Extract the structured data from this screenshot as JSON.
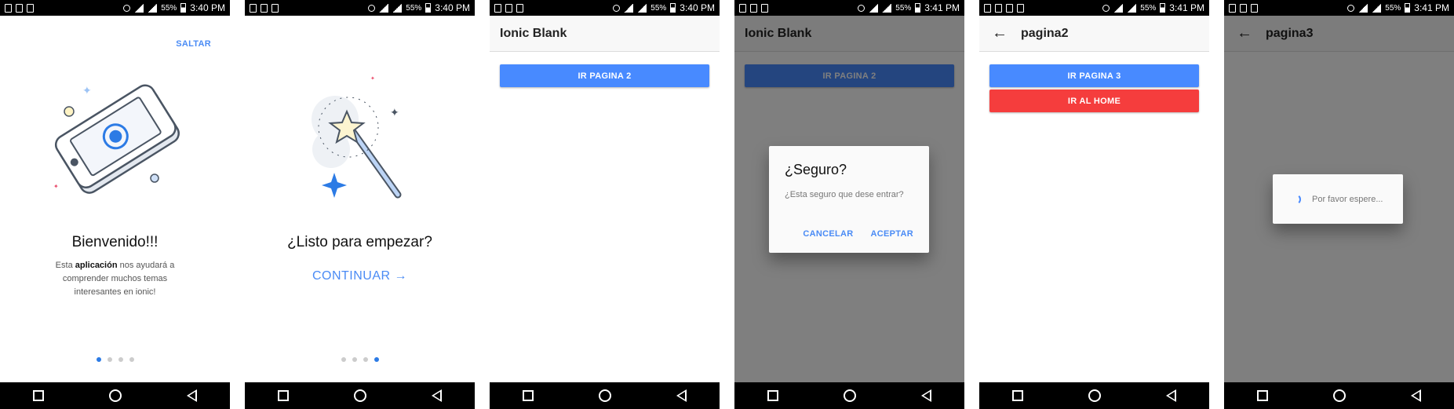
{
  "statusbar": [
    {
      "battery": "55%",
      "time": "3:40 PM"
    },
    {
      "battery": "55%",
      "time": "3:40 PM"
    },
    {
      "battery": "55%",
      "time": "3:40 PM"
    },
    {
      "battery": "55%",
      "time": "3:41 PM"
    },
    {
      "battery": "55%",
      "time": "3:41 PM"
    },
    {
      "battery": "55%",
      "time": "3:41 PM"
    }
  ],
  "intro1": {
    "skip": "SALTAR",
    "title": "Bienvenido!!!",
    "text_pre": "Esta ",
    "text_bold": "aplicación",
    "text_post": " nos ayudará a comprender muchos temas interesantes en ionic!",
    "active_dot": 1
  },
  "intro2": {
    "title": "¿Listo para empezar?",
    "continue": "CONTINUAR",
    "active_dot": 4
  },
  "home": {
    "title": "Ionic Blank",
    "button": "IR PAGINA 2"
  },
  "confirm": {
    "title": "¿Seguro?",
    "message": "¿Esta seguro que dese entrar?",
    "cancel": "CANCELAR",
    "accept": "ACEPTAR"
  },
  "pagina2": {
    "title": "pagina2",
    "button_page3": "IR PAGINA 3",
    "button_home": "IR AL HOME"
  },
  "pagina3": {
    "title": "pagina3",
    "loading": "Por favor espere..."
  },
  "colors": {
    "primary": "#488aff",
    "danger": "#f53d3d",
    "link": "#4a8bf5"
  }
}
